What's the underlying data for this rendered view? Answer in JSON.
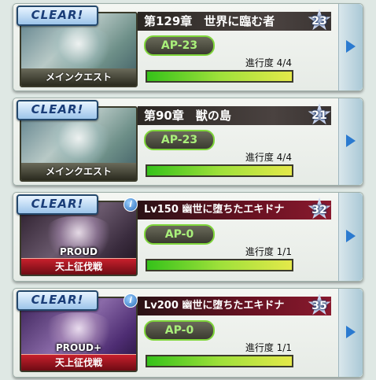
{
  "quests": [
    {
      "clear": "CLEAR!",
      "caption": "メインクエスト",
      "title": "第129章　世界に臨む者",
      "star": "23",
      "ap": "AP-23",
      "progress_text": "進行度 4/4",
      "progress_fraction": 1.0
    },
    {
      "clear": "CLEAR!",
      "caption": "メインクエスト",
      "title": "第90章　獣の島",
      "star": "21",
      "ap": "AP-23",
      "progress_text": "進行度 4/4",
      "progress_fraction": 1.0
    },
    {
      "clear": "CLEAR!",
      "info": "i",
      "difficulty": "PROUD",
      "caption": "天上征伐戦",
      "title": "Lv150 幽世に堕ちたエキドナ",
      "star": "32",
      "ap": "AP-0",
      "progress_text": "進行度 1/1",
      "progress_fraction": 1.0
    },
    {
      "clear": "CLEAR!",
      "info": "i",
      "difficulty": "PROUD+",
      "caption": "天上征伐戦",
      "title": "Lv200 幽世に堕ちたエキドナ",
      "star": "35",
      "ap": "AP-0",
      "progress_text": "進行度 1/1",
      "progress_fraction": 1.0
    }
  ],
  "icons": {
    "arrow": "play-arrow-icon",
    "star": "star-icon",
    "info": "info-icon"
  },
  "colors": {
    "ap_border": "#7fd63a",
    "ap_text": "#a9f07a",
    "arrow": "#2a7ad0"
  }
}
